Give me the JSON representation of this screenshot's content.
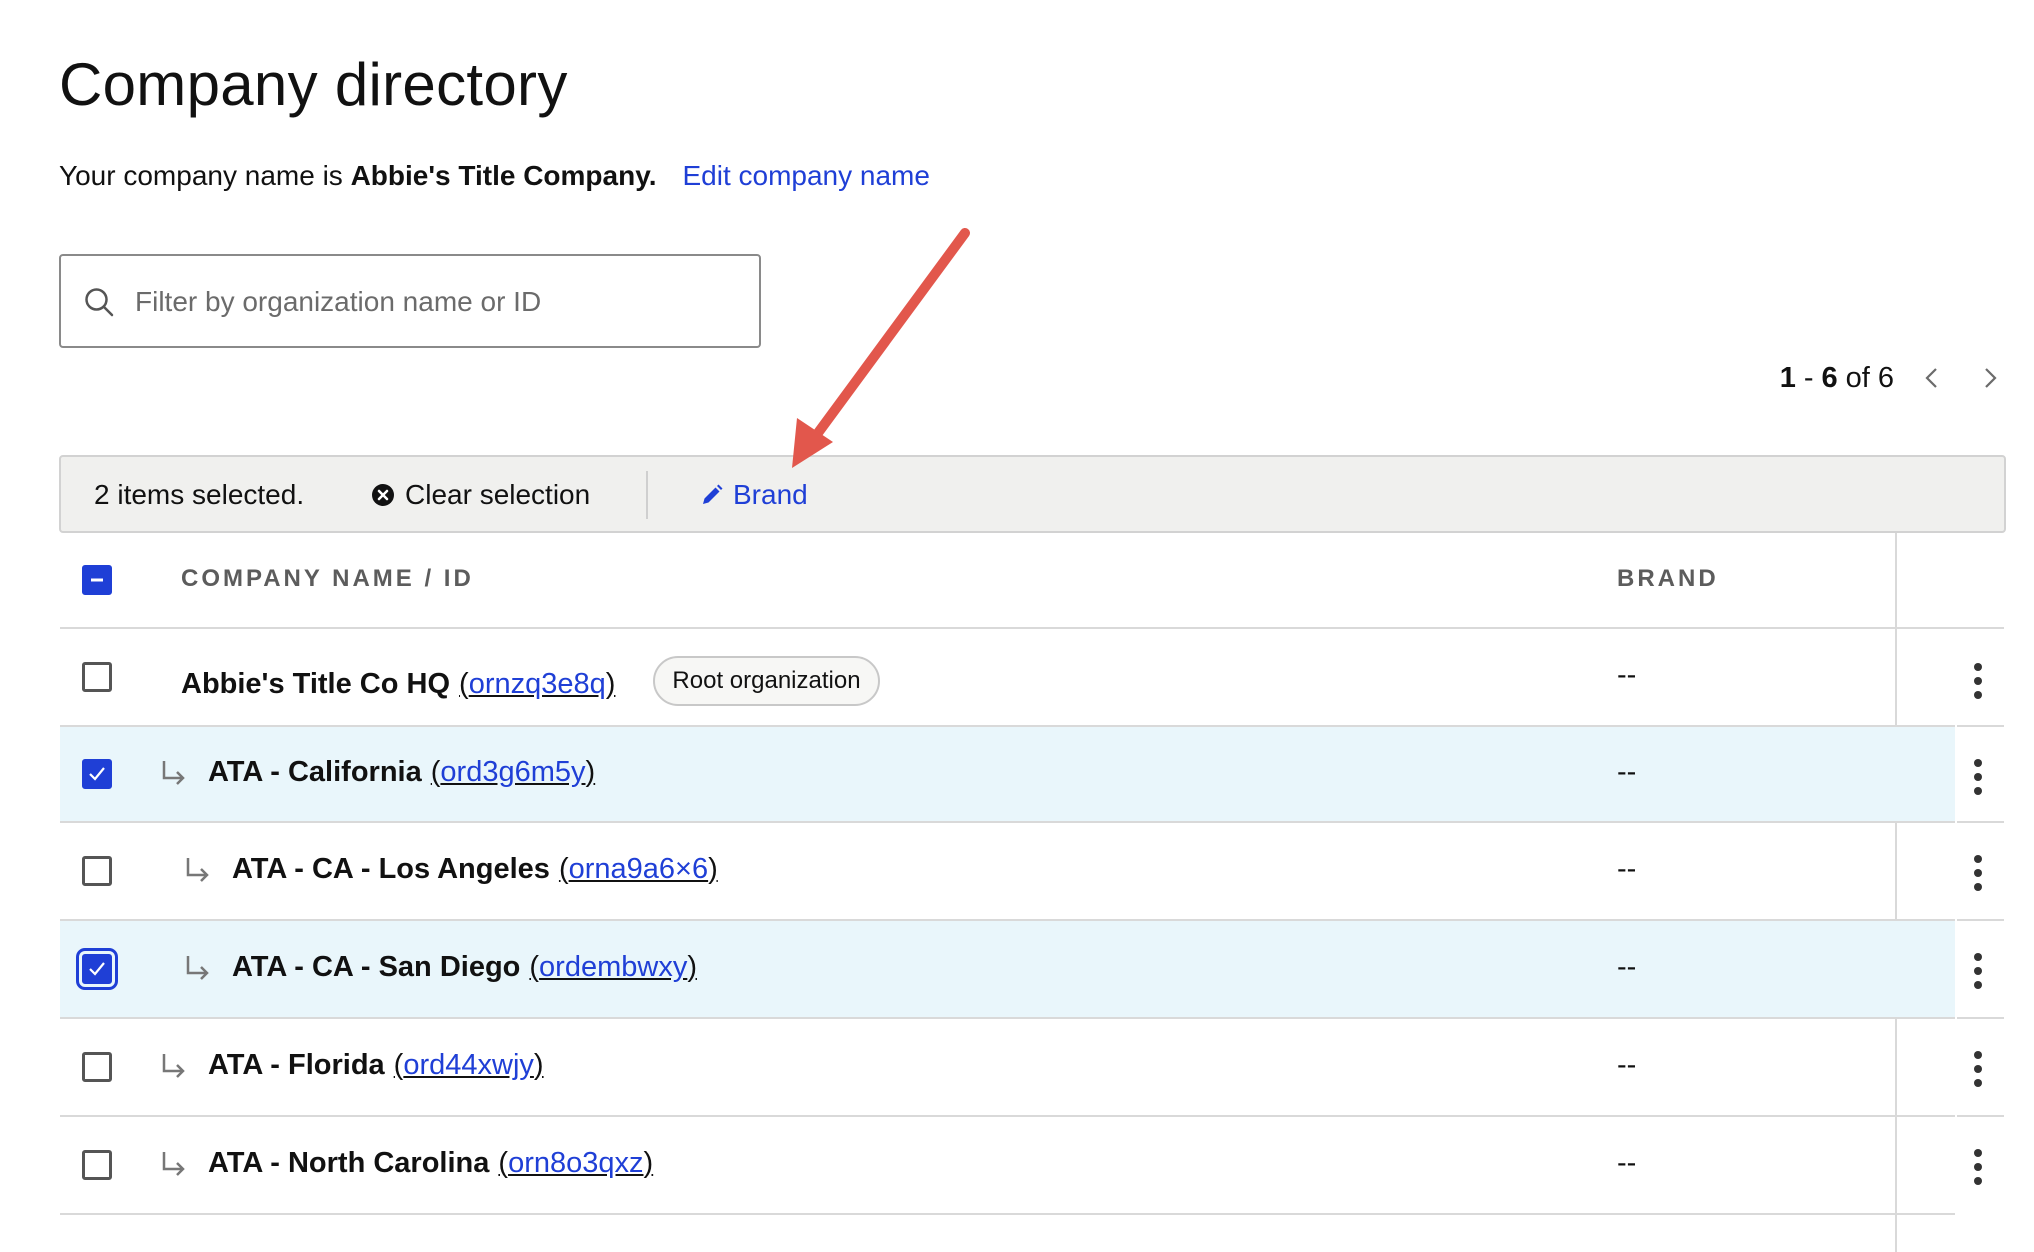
{
  "page": {
    "title": "Company directory",
    "subtitle_prefix": "Your company name is ",
    "company_name": "Abbie's Title Company.",
    "edit_link": "Edit company name"
  },
  "search": {
    "placeholder": "Filter by organization name or ID",
    "value": ""
  },
  "pagination": {
    "start": "1",
    "dash": "-",
    "end": "6",
    "of": "of",
    "total": "6"
  },
  "selection_bar": {
    "count_text": "2 items selected.",
    "clear_label": "Clear selection",
    "brand_label": "Brand"
  },
  "table": {
    "columns": {
      "name": "COMPANY NAME / ID",
      "brand": "BRAND"
    },
    "rows": [
      {
        "name": "Abbie's Title Co HQ",
        "id_open": "(",
        "id": "ornzq3e8q",
        "id_close": ")",
        "badge": "Root organization",
        "brand": "--",
        "selected": false
      },
      {
        "name": "ATA - California",
        "id_open": "(",
        "id": "ord3g6m5y",
        "id_close": ")",
        "brand": "--",
        "selected": true
      },
      {
        "name": "ATA - CA - Los Angeles",
        "id_open": "(",
        "id": "orna9a6×6",
        "id_close": ")",
        "brand": "--",
        "selected": false
      },
      {
        "name": "ATA - CA - San Diego",
        "id_open": "(",
        "id": "ordembwxy",
        "id_close": ")",
        "brand": "--",
        "selected": true
      },
      {
        "name": "ATA - Florida",
        "id_open": "(",
        "id": "ord44xwjy",
        "id_close": ")",
        "brand": "--",
        "selected": false
      },
      {
        "name": "ATA - North Carolina",
        "id_open": "(",
        "id": "orn8o3qxz",
        "id_close": ")",
        "brand": "--",
        "selected": false
      }
    ]
  },
  "icons": {
    "search": "search-icon",
    "clear": "close-circle-icon",
    "brand": "pencil-icon",
    "prev": "chevron-left-icon",
    "next": "chevron-right-icon",
    "child": "child-arrow-icon",
    "more": "more-vertical-icon",
    "annotation": "annotation-arrow"
  },
  "colors": {
    "link": "#1f3fd6",
    "checkbox_checked": "#1f3fd6",
    "selected_row": "#e9f6fb",
    "selection_bar": "#f0f0ee",
    "annotation_arrow": "#e2574c"
  }
}
